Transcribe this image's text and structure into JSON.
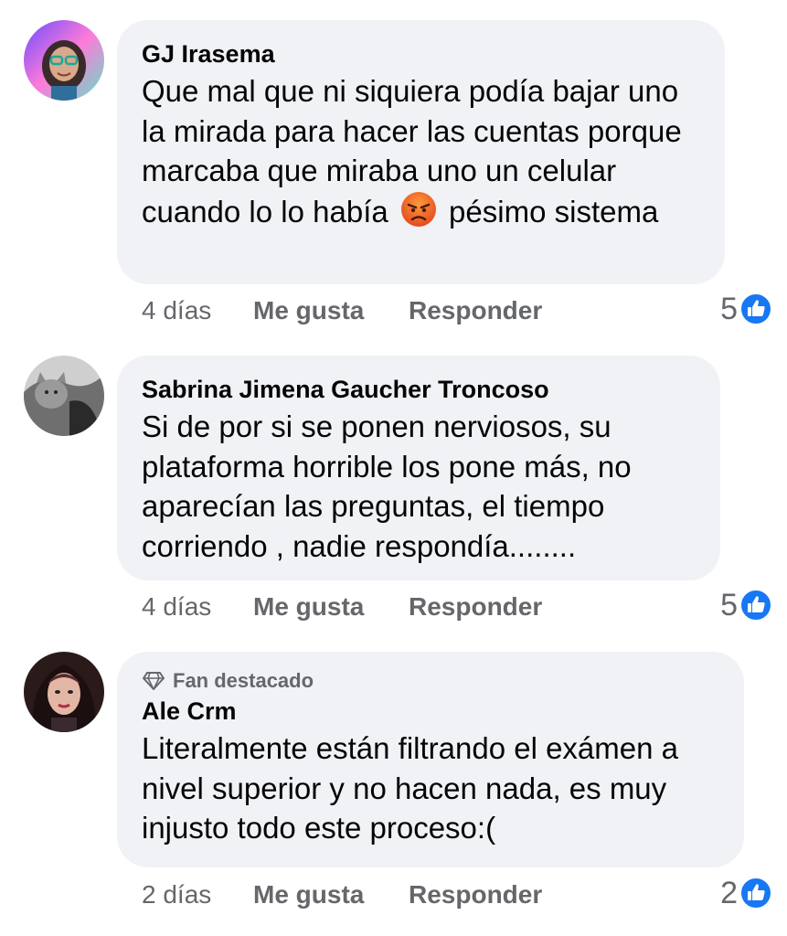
{
  "comments": [
    {
      "author": "GJ Irasema",
      "text_before_emoji": "Que mal que ni siquiera podía bajar uno la mirada para hacer las cuentas porque marcaba que miraba uno un celular cuando lo lo había",
      "emoji": "angry-face-icon",
      "text_after_emoji": "pésimo sistema",
      "time": "4 días",
      "like_label": "Me gusta",
      "reply_label": "Responder",
      "reaction_count": "5",
      "reaction_icon": "like-icon"
    },
    {
      "author": "Sabrina Jimena Gaucher Troncoso",
      "text": "Si de por si se ponen nerviosos, su plataforma horrible los pone más, no aparecían las preguntas,  el tiempo corriendo , nadie respondía........",
      "time": "4 días",
      "like_label": "Me gusta",
      "reply_label": "Responder",
      "reaction_count": "5",
      "reaction_icon": "like-icon"
    },
    {
      "badge": "Fan destacado",
      "badge_icon": "diamond-icon",
      "author": "Ale Crm",
      "text": "Literalmente están filtrando el exámen a nivel superior y no hacen nada, es muy injusto todo este proceso:(",
      "time": "2 días",
      "like_label": "Me gusta",
      "reply_label": "Responder",
      "reaction_count": "2",
      "reaction_icon": "like-icon"
    }
  ],
  "colors": {
    "bubble_bg": "#f0f2f5",
    "secondary_text": "#65676b",
    "like_blue": "#1877f2"
  }
}
